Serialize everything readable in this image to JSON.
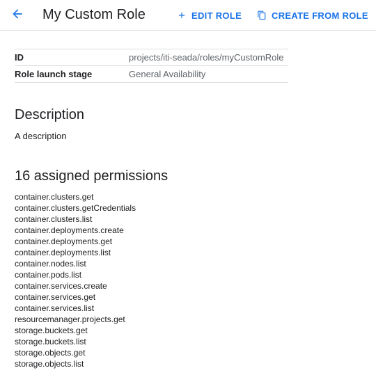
{
  "header": {
    "title": "My Custom Role",
    "back_icon": "arrow-back-icon",
    "edit_label": "EDIT ROLE",
    "edit_icon": "plus-icon",
    "create_label": "CREATE FROM ROLE",
    "create_icon": "copy-icon",
    "accent_color": "#1a73e8"
  },
  "details": {
    "rows": [
      {
        "key": "ID",
        "value": "projects/iti-seada/roles/myCustomRole"
      },
      {
        "key": "Role launch stage",
        "value": "General Availability"
      }
    ]
  },
  "description": {
    "title": "Description",
    "text": "A description"
  },
  "permissions": {
    "title": "16 assigned permissions",
    "items": [
      "container.clusters.get",
      "container.clusters.getCredentials",
      "container.clusters.list",
      "container.deployments.create",
      "container.deployments.get",
      "container.deployments.list",
      "container.nodes.list",
      "container.pods.list",
      "container.services.create",
      "container.services.get",
      "container.services.list",
      "resourcemanager.projects.get",
      "storage.buckets.get",
      "storage.buckets.list",
      "storage.objects.get",
      "storage.objects.list"
    ]
  }
}
